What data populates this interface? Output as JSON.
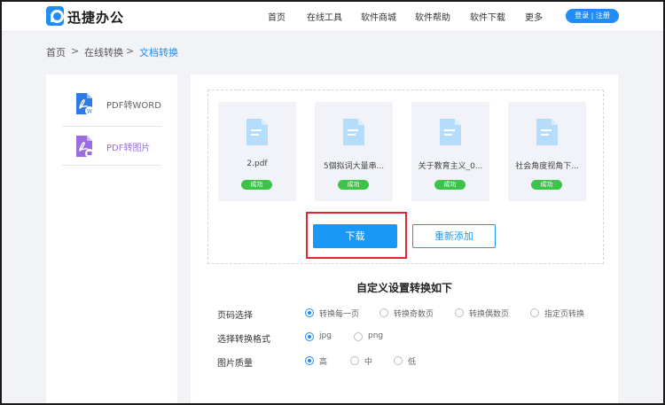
{
  "header": {
    "logo_text": "迅捷办公",
    "nav": [
      "首页",
      "在线工具",
      "软件商城",
      "软件帮助",
      "软件下载",
      "更多"
    ],
    "login_label": "登录 | 注册"
  },
  "breadcrumb": [
    "首页",
    ">",
    "在线转换",
    ">",
    "文档转换"
  ],
  "sidebar": {
    "items": [
      {
        "label": "PDF转WORD",
        "icon": "pdf-to-word-icon"
      },
      {
        "label": "PDF转图片",
        "icon": "pdf-to-image-icon"
      }
    ]
  },
  "files": [
    {
      "name": "2.pdf",
      "status": "成功"
    },
    {
      "name": "5個拟词大量串...",
      "status": "成功"
    },
    {
      "name": "关于教育主义_0...",
      "status": "成功"
    },
    {
      "name": "社会角度视角下...",
      "status": "成功"
    }
  ],
  "actions": {
    "download": "下载",
    "readd": "重新添加"
  },
  "settings": {
    "title": "自定义设置转换如下",
    "page_select": {
      "label": "页码选择",
      "options": [
        "转换每一页",
        "转换奇数页",
        "转换偶数页",
        "指定页转换"
      ],
      "selected": 0
    },
    "format": {
      "label": "选择转换格式",
      "options": [
        "jpg",
        "png"
      ],
      "selected": 0
    },
    "quality": {
      "label": "图片质量",
      "options": [
        "高",
        "中",
        "低"
      ],
      "selected": 0
    }
  },
  "colors": {
    "accent": "#1f8df5",
    "success": "#3dc24a",
    "highlight": "#e0262e",
    "link": "#1f8df5"
  }
}
